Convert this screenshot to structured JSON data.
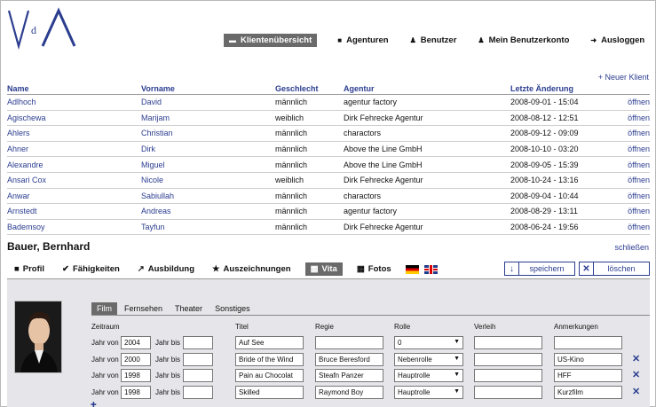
{
  "logo": {
    "letters_left": "V",
    "letters_small": "d",
    "letters_right": "A"
  },
  "nav": [
    {
      "label": "Klientenübersicht",
      "icon": "minus-icon",
      "active": true
    },
    {
      "label": "Agenturen",
      "icon": "square-icon",
      "active": false
    },
    {
      "label": "Benutzer",
      "icon": "person-icon",
      "active": false
    },
    {
      "label": "Mein Benutzerkonto",
      "icon": "person-icon",
      "active": false
    },
    {
      "label": "Ausloggen",
      "icon": "arrow-right-icon",
      "active": false
    }
  ],
  "new_client": "+ Neuer Klient",
  "clients": {
    "headers": [
      "Name",
      "Vorname",
      "Geschlecht",
      "Agentur",
      "Letzte Änderung"
    ],
    "open_label": "öffnen",
    "rows": [
      {
        "name": "Adlhoch",
        "vorname": "David",
        "geschlecht": "männlich",
        "agentur": "agentur factory",
        "datum": "2008-09-01 - 15:04"
      },
      {
        "name": "Agischewa",
        "vorname": "Marijam",
        "geschlecht": "weiblich",
        "agentur": "Dirk Fehrecke Agentur",
        "datum": "2008-08-12 - 12:51"
      },
      {
        "name": "Ahlers",
        "vorname": "Christian",
        "geschlecht": "männlich",
        "agentur": "charactors",
        "datum": "2008-09-12 - 09:09"
      },
      {
        "name": "Ahner",
        "vorname": "Dirk",
        "geschlecht": "männlich",
        "agentur": "Above the Line GmbH",
        "datum": "2008-10-10 - 03:20"
      },
      {
        "name": "Alexandre",
        "vorname": "Miguel",
        "geschlecht": "männlich",
        "agentur": "Above the Line GmbH",
        "datum": "2008-09-05 - 15:39"
      },
      {
        "name": "Ansari Cox",
        "vorname": "Nicole",
        "geschlecht": "weiblich",
        "agentur": "Dirk Fehrecke Agentur",
        "datum": "2008-10-24 - 13:16"
      },
      {
        "name": "Anwar",
        "vorname": "Sabiullah",
        "geschlecht": "männlich",
        "agentur": "charactors",
        "datum": "2008-09-04 - 10:44"
      },
      {
        "name": "Arnstedt",
        "vorname": "Andreas",
        "geschlecht": "männlich",
        "agentur": "agentur factory",
        "datum": "2008-08-29 - 13:11"
      },
      {
        "name": "Bademsoy",
        "vorname": "Tayfun",
        "geschlecht": "männlich",
        "agentur": "Dirk Fehrecke Agentur",
        "datum": "2008-06-24 - 19:56"
      }
    ]
  },
  "detail": {
    "name": "Bauer, Bernhard",
    "close": "schließen",
    "tabs": [
      {
        "label": "Profil",
        "icon": "square-icon"
      },
      {
        "label": "Fähigkeiten",
        "icon": "check-icon"
      },
      {
        "label": "Ausbildung",
        "icon": "arrow-up-right-icon"
      },
      {
        "label": "Auszeichnungen",
        "icon": "star-icon"
      },
      {
        "label": "Vita",
        "icon": "grid-icon",
        "active": true
      },
      {
        "label": "Fotos",
        "icon": "grid-icon"
      }
    ],
    "save": "speichern",
    "delete": "löschen"
  },
  "vita": {
    "subtabs": [
      "Film",
      "Fernsehen",
      "Theater",
      "Sonstiges"
    ],
    "headers": {
      "zeitraum": "Zeitraum",
      "titel": "Titel",
      "regie": "Regie",
      "rolle": "Rolle",
      "verleih": "Verleih",
      "anmerkungen": "Anmerkungen"
    },
    "from_label": "Jahr von",
    "to_label": "Jahr bis",
    "rows": [
      {
        "von": "2004",
        "bis": "",
        "titel": "Auf See",
        "regie": "",
        "rolle": "0",
        "verleih": "",
        "anmerkung": "",
        "deletable": false
      },
      {
        "von": "2000",
        "bis": "",
        "titel": "Bride of the Wind",
        "regie": "Bruce Beresford",
        "rolle": "Nebenrolle",
        "verleih": "",
        "anmerkung": "US-Kino",
        "deletable": true
      },
      {
        "von": "1998",
        "bis": "",
        "titel": "Pain au Chocolat",
        "regie": "Steafn Panzer",
        "rolle": "Hauptrolle",
        "verleih": "",
        "anmerkung": "HFF",
        "deletable": true
      },
      {
        "von": "1998",
        "bis": "",
        "titel": "Skilled",
        "regie": "Raymond Boy",
        "rolle": "Hauptrolle",
        "verleih": "",
        "anmerkung": "Kurzfilm",
        "deletable": true
      }
    ]
  }
}
